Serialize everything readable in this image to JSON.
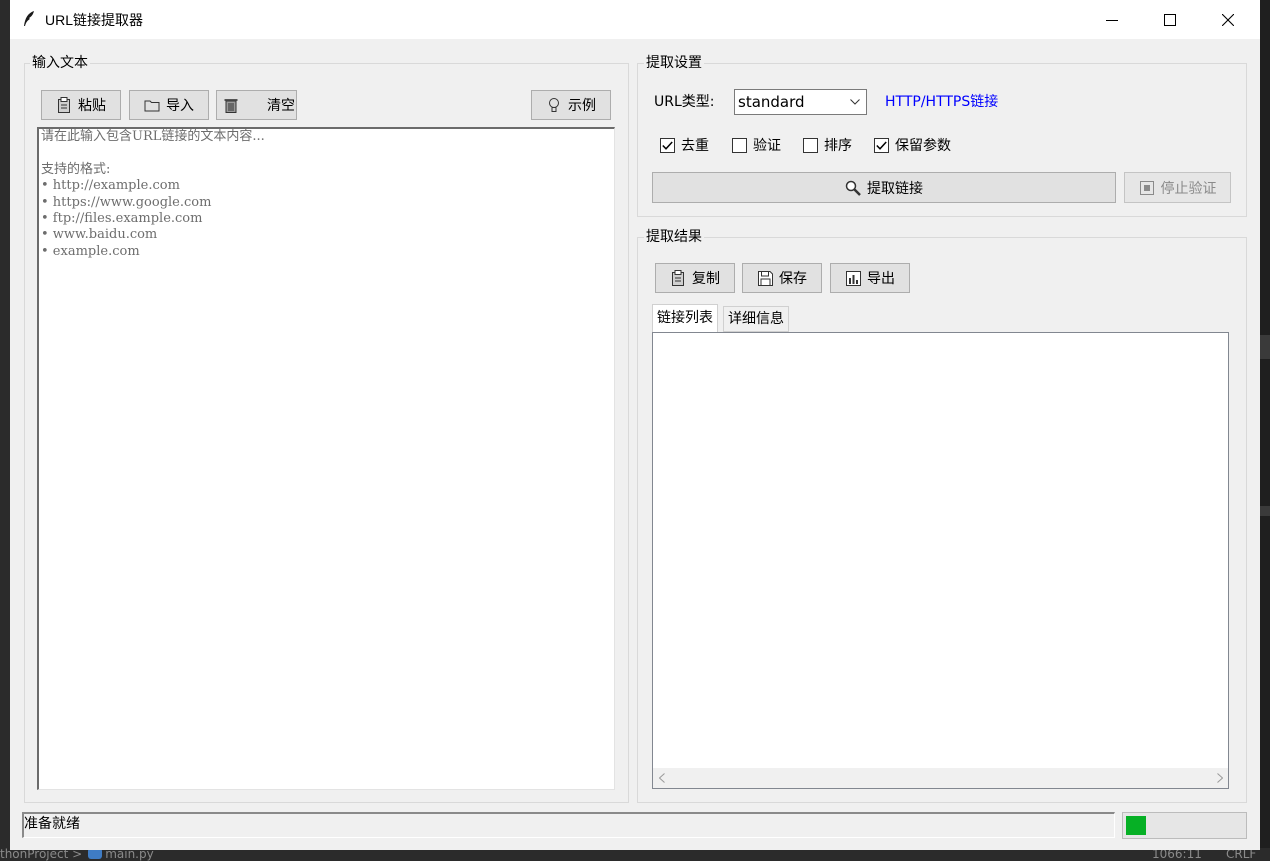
{
  "window": {
    "title": "URL链接提取器"
  },
  "input_panel": {
    "group_label": "输入文本",
    "buttons": {
      "paste": "粘贴",
      "import": "导入",
      "clear": "清空",
      "example": "示例"
    },
    "placeholder_text": "请在此输入包含URL链接的文本内容...\n\n支持的格式:\n• http://example.com\n• https://www.google.com\n• ftp://files.example.com\n• www.baidu.com\n• example.com"
  },
  "settings_panel": {
    "group_label": "提取设置",
    "url_type_label": "URL类型:",
    "url_type_value": "standard",
    "url_type_desc": "HTTP/HTTPS链接",
    "options": [
      {
        "label": "去重",
        "checked": true
      },
      {
        "label": "验证",
        "checked": false
      },
      {
        "label": "排序",
        "checked": false
      },
      {
        "label": "保留参数",
        "checked": true
      }
    ],
    "extract_label": "提取链接",
    "stop_label": "停止验证"
  },
  "results_panel": {
    "group_label": "提取结果",
    "buttons": {
      "copy": "复制",
      "save": "保存",
      "export": "导出"
    },
    "tabs": [
      {
        "label": "链接列表",
        "active": true
      },
      {
        "label": "详细信息",
        "active": false
      }
    ],
    "links": []
  },
  "status": {
    "text": "准备就绪",
    "progress": 0.17
  },
  "ide": {
    "crumb": "thonProject  >",
    "file": "main.py",
    "cursor": "1066:11",
    "line_ending": "CRLF"
  },
  "colors": {
    "accent_link": "#0000ff",
    "progress_fill": "#06b025",
    "window_bg": "#f0f0f0"
  }
}
